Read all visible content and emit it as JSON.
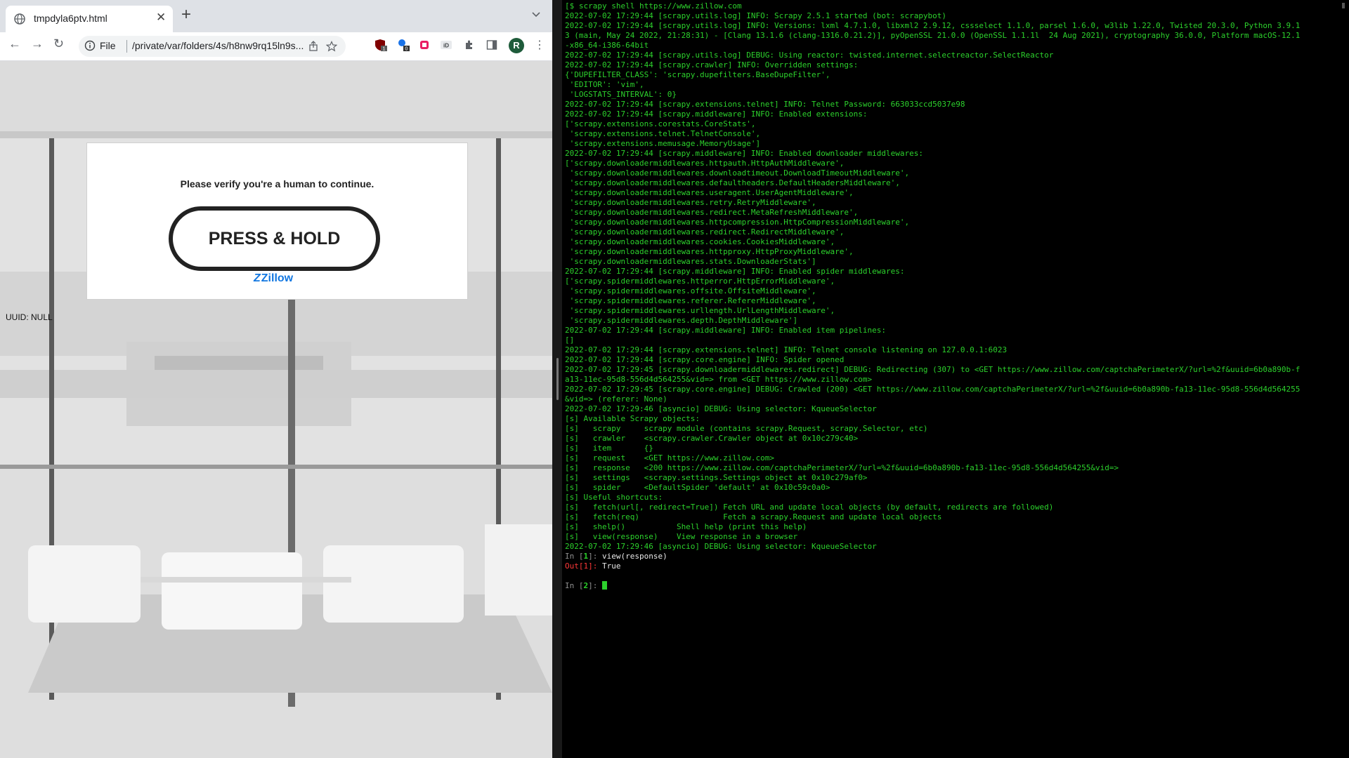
{
  "browser": {
    "tab": {
      "title": "tmpdyla6ptv.html"
    },
    "address_bar": {
      "scheme_label": "File",
      "url": "/private/var/folders/4s/h8nw9rq15ln9s..."
    },
    "profile_initial": "R",
    "extension_badges": [
      "1",
      "0"
    ]
  },
  "page": {
    "captcha": {
      "message": "Please verify you're a human to continue.",
      "button_label": "PRESS & HOLD",
      "logo_text": "Zillow"
    },
    "uuid_text": "UUID: NULL"
  },
  "terminal": {
    "lines": [
      "[$ scrapy shell https://www.zillow.com",
      "2022-07-02 17:29:44 [scrapy.utils.log] INFO: Scrapy 2.5.1 started (bot: scrapybot)",
      "2022-07-02 17:29:44 [scrapy.utils.log] INFO: Versions: lxml 4.7.1.0, libxml2 2.9.12, cssselect 1.1.0, parsel 1.6.0, w3lib 1.22.0, Twisted 20.3.0, Python 3.9.1",
      "3 (main, May 24 2022, 21:28:31) - [Clang 13.1.6 (clang-1316.0.21.2)], pyOpenSSL 21.0.0 (OpenSSL 1.1.1l  24 Aug 2021), cryptography 36.0.0, Platform macOS-12.1",
      "-x86_64-i386-64bit",
      "2022-07-02 17:29:44 [scrapy.utils.log] DEBUG: Using reactor: twisted.internet.selectreactor.SelectReactor",
      "2022-07-02 17:29:44 [scrapy.crawler] INFO: Overridden settings:",
      "{'DUPEFILTER_CLASS': 'scrapy.dupefilters.BaseDupeFilter',",
      " 'EDITOR': 'vim',",
      " 'LOGSTATS_INTERVAL': 0}",
      "2022-07-02 17:29:44 [scrapy.extensions.telnet] INFO: Telnet Password: 663033ccd5037e98",
      "2022-07-02 17:29:44 [scrapy.middleware] INFO: Enabled extensions:",
      "['scrapy.extensions.corestats.CoreStats',",
      " 'scrapy.extensions.telnet.TelnetConsole',",
      " 'scrapy.extensions.memusage.MemoryUsage']",
      "2022-07-02 17:29:44 [scrapy.middleware] INFO: Enabled downloader middlewares:",
      "['scrapy.downloadermiddlewares.httpauth.HttpAuthMiddleware',",
      " 'scrapy.downloadermiddlewares.downloadtimeout.DownloadTimeoutMiddleware',",
      " 'scrapy.downloadermiddlewares.defaultheaders.DefaultHeadersMiddleware',",
      " 'scrapy.downloadermiddlewares.useragent.UserAgentMiddleware',",
      " 'scrapy.downloadermiddlewares.retry.RetryMiddleware',",
      " 'scrapy.downloadermiddlewares.redirect.MetaRefreshMiddleware',",
      " 'scrapy.downloadermiddlewares.httpcompression.HttpCompressionMiddleware',",
      " 'scrapy.downloadermiddlewares.redirect.RedirectMiddleware',",
      " 'scrapy.downloadermiddlewares.cookies.CookiesMiddleware',",
      " 'scrapy.downloadermiddlewares.httpproxy.HttpProxyMiddleware',",
      " 'scrapy.downloadermiddlewares.stats.DownloaderStats']",
      "2022-07-02 17:29:44 [scrapy.middleware] INFO: Enabled spider middlewares:",
      "['scrapy.spidermiddlewares.httperror.HttpErrorMiddleware',",
      " 'scrapy.spidermiddlewares.offsite.OffsiteMiddleware',",
      " 'scrapy.spidermiddlewares.referer.RefererMiddleware',",
      " 'scrapy.spidermiddlewares.urllength.UrlLengthMiddleware',",
      " 'scrapy.spidermiddlewares.depth.DepthMiddleware']",
      "2022-07-02 17:29:44 [scrapy.middleware] INFO: Enabled item pipelines:",
      "[]",
      "2022-07-02 17:29:44 [scrapy.extensions.telnet] INFO: Telnet console listening on 127.0.0.1:6023",
      "2022-07-02 17:29:44 [scrapy.core.engine] INFO: Spider opened",
      "2022-07-02 17:29:45 [scrapy.downloadermiddlewares.redirect] DEBUG: Redirecting (307) to <GET https://www.zillow.com/captchaPerimeterX/?url=%2f&uuid=6b0a890b-f",
      "a13-11ec-95d8-556d4d564255&vid=> from <GET https://www.zillow.com>",
      "2022-07-02 17:29:45 [scrapy.core.engine] DEBUG: Crawled (200) <GET https://www.zillow.com/captchaPerimeterX/?url=%2f&uuid=6b0a890b-fa13-11ec-95d8-556d4d564255",
      "&vid=> (referer: None)",
      "2022-07-02 17:29:46 [asyncio] DEBUG: Using selector: KqueueSelector",
      "[s] Available Scrapy objects:",
      "[s]   scrapy     scrapy module (contains scrapy.Request, scrapy.Selector, etc)",
      "[s]   crawler    <scrapy.crawler.Crawler object at 0x10c279c40>",
      "[s]   item       {}",
      "[s]   request    <GET https://www.zillow.com>",
      "[s]   response   <200 https://www.zillow.com/captchaPerimeterX/?url=%2f&uuid=6b0a890b-fa13-11ec-95d8-556d4d564255&vid=>",
      "[s]   settings   <scrapy.settings.Settings object at 0x10c279af0>",
      "[s]   spider     <DefaultSpider 'default' at 0x10c59c0a0>",
      "[s] Useful shortcuts:",
      "[s]   fetch(url[, redirect=True]) Fetch URL and update local objects (by default, redirects are followed)",
      "[s]   fetch(req)                  Fetch a scrapy.Request and update local objects",
      "[s]   shelp()           Shell help (print this help)",
      "[s]   view(response)    View response in a browser",
      "2022-07-02 17:29:46 [asyncio] DEBUG: Using selector: KqueueSelector"
    ],
    "prompt_in1": {
      "prefix": "In [",
      "num": "1",
      "suffix": "]: ",
      "cmd": "view(response)"
    },
    "prompt_out1": {
      "prefix": "Out[",
      "num": "1",
      "suffix": "]: ",
      "value": "True"
    },
    "prompt_in2": {
      "prefix": "In [",
      "num": "2",
      "suffix": "]: "
    }
  },
  "colors": {
    "terminal_text": "#2cd12c",
    "terminal_bg": "#000000",
    "out_prompt": "#ff3838",
    "zillow_blue": "#1277e1"
  }
}
